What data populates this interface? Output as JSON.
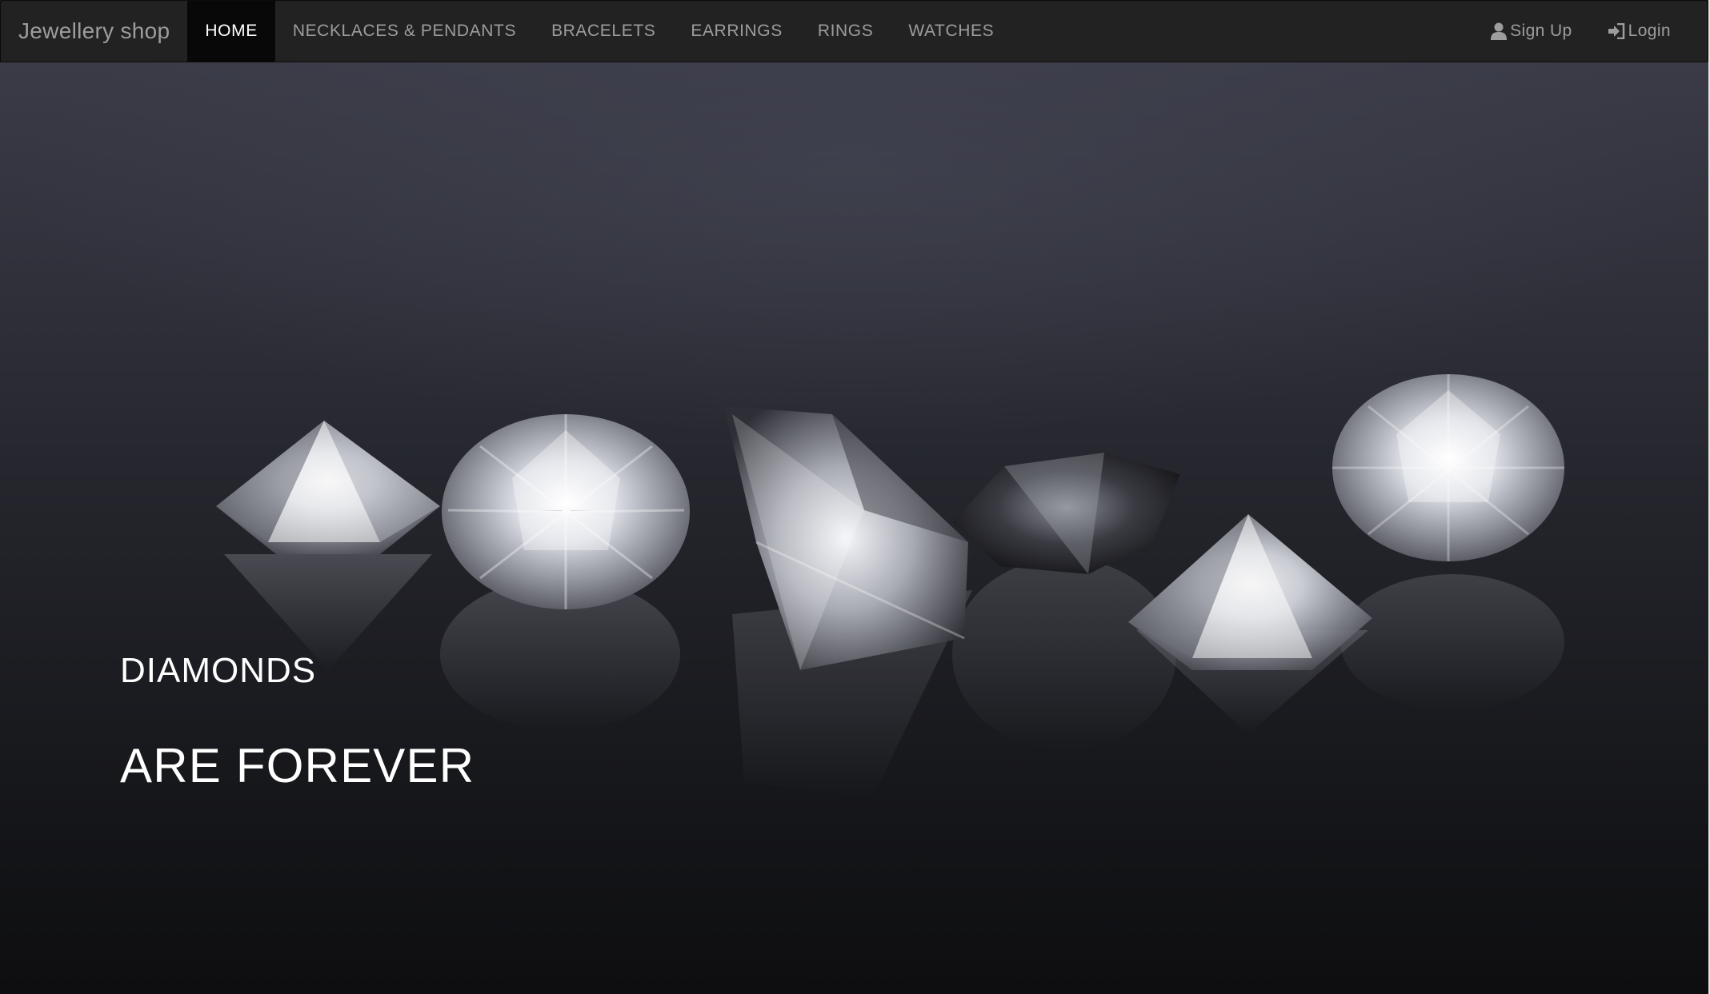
{
  "navbar": {
    "brand": "Jewellery shop",
    "items": [
      {
        "label": "HOME",
        "active": true
      },
      {
        "label": "NECKLACES & PENDANTS",
        "active": false
      },
      {
        "label": "BRACELETS",
        "active": false
      },
      {
        "label": "EARRINGS",
        "active": false
      },
      {
        "label": "RINGS",
        "active": false
      },
      {
        "label": "WATCHES",
        "active": false
      }
    ],
    "signup_label": "Sign Up",
    "login_label": "Login",
    "signup_icon": "user-icon",
    "login_icon": "login-icon"
  },
  "hero": {
    "line1": "DIAMONDS",
    "line2": "ARE FOREVER",
    "image": "diamonds-photo"
  },
  "colors": {
    "navbar_bg": "#222222",
    "nav_text": "#9d9d9d",
    "nav_active_bg": "#080808",
    "nav_active_text": "#ffffff",
    "hero_text": "#ffffff"
  }
}
